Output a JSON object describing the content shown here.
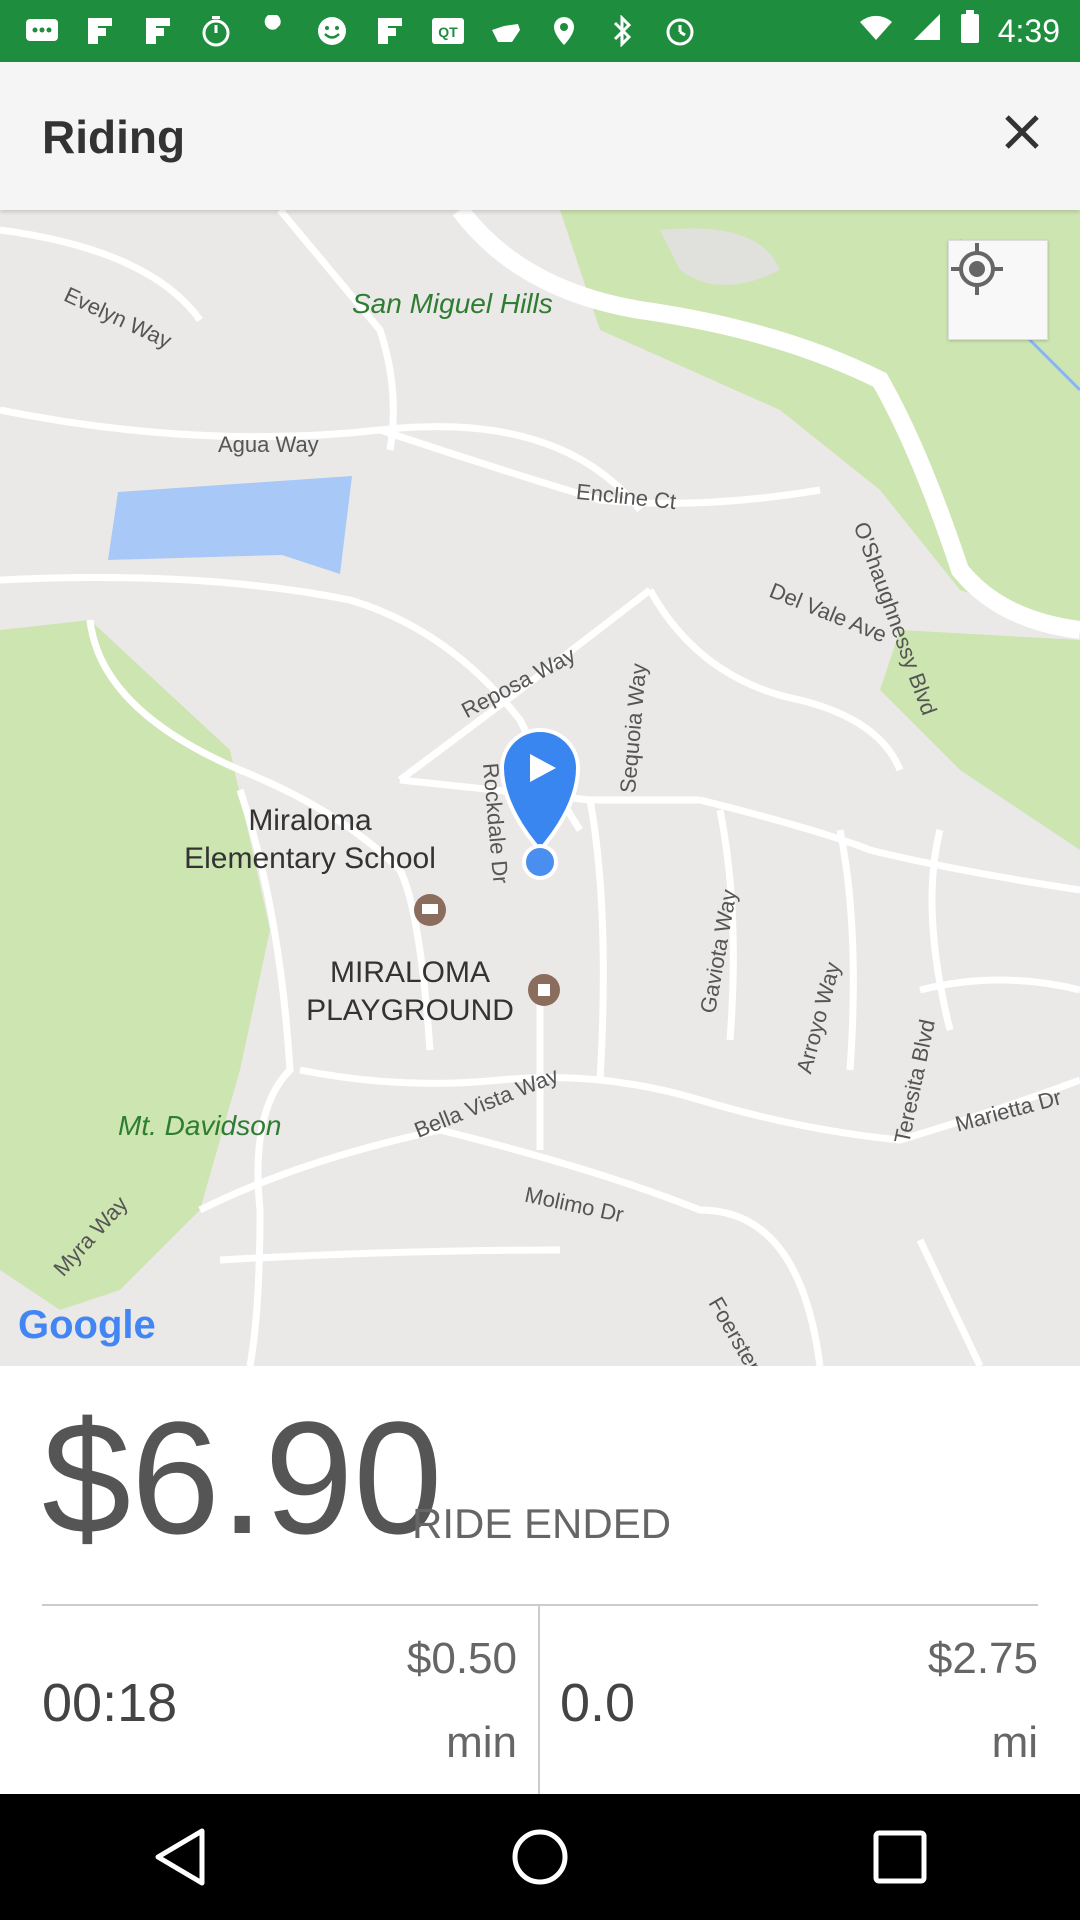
{
  "status_bar": {
    "time": "4:39",
    "icons": [
      "messages-icon",
      "flipboard-icon",
      "flipboard-icon",
      "timer-icon",
      "wrench-icon",
      "smiley-icon",
      "flipboard-icon",
      "qr-icon",
      "hand-icon",
      "location-pin-icon",
      "bluetooth-icon",
      "alarm-icon",
      "wifi-icon",
      "signal-icon",
      "battery-icon"
    ]
  },
  "header": {
    "title": "Riding",
    "close_icon": "close-icon"
  },
  "map": {
    "labels": {
      "san_miguel": "San Miguel Hills",
      "evelyn": "Evelyn Way",
      "agua": "Agua Way",
      "encline": "Encline Ct",
      "oshaughnessy": "O'Shaughnessy Blvd",
      "del_vale": "Del Vale Ave",
      "reposa": "Reposa Way",
      "rockdale": "Rockdale Dr",
      "sequoia": "Sequoia Way",
      "gaviota": "Gaviota Way",
      "arroyo": "Arroyo Way",
      "teresita": "Teresita Blvd",
      "marietta": "Marietta Dr",
      "bella_vista": "Bella Vista Way",
      "molimo": "Molimo Dr",
      "myra": "Myra Way",
      "foerster": "Foerster",
      "mt_davidson": "Mt. Davidson",
      "school_line1": "Miraloma",
      "school_line2": "Elementary School",
      "playground_line1": "MIRALOMA",
      "playground_line2": "PLAYGROUND"
    },
    "logo": "Google",
    "my_location_icon": "my-location-icon"
  },
  "ride": {
    "fare": "$6.90",
    "status": "RIDE ENDED",
    "time_value": "00:18",
    "time_rate": "$0.50",
    "time_unit": "min",
    "distance_value": "0.0",
    "distance_rate": "$2.75",
    "distance_unit": "mi"
  },
  "nav_bar": {
    "icons": [
      "back-icon",
      "home-icon",
      "recents-icon"
    ]
  }
}
